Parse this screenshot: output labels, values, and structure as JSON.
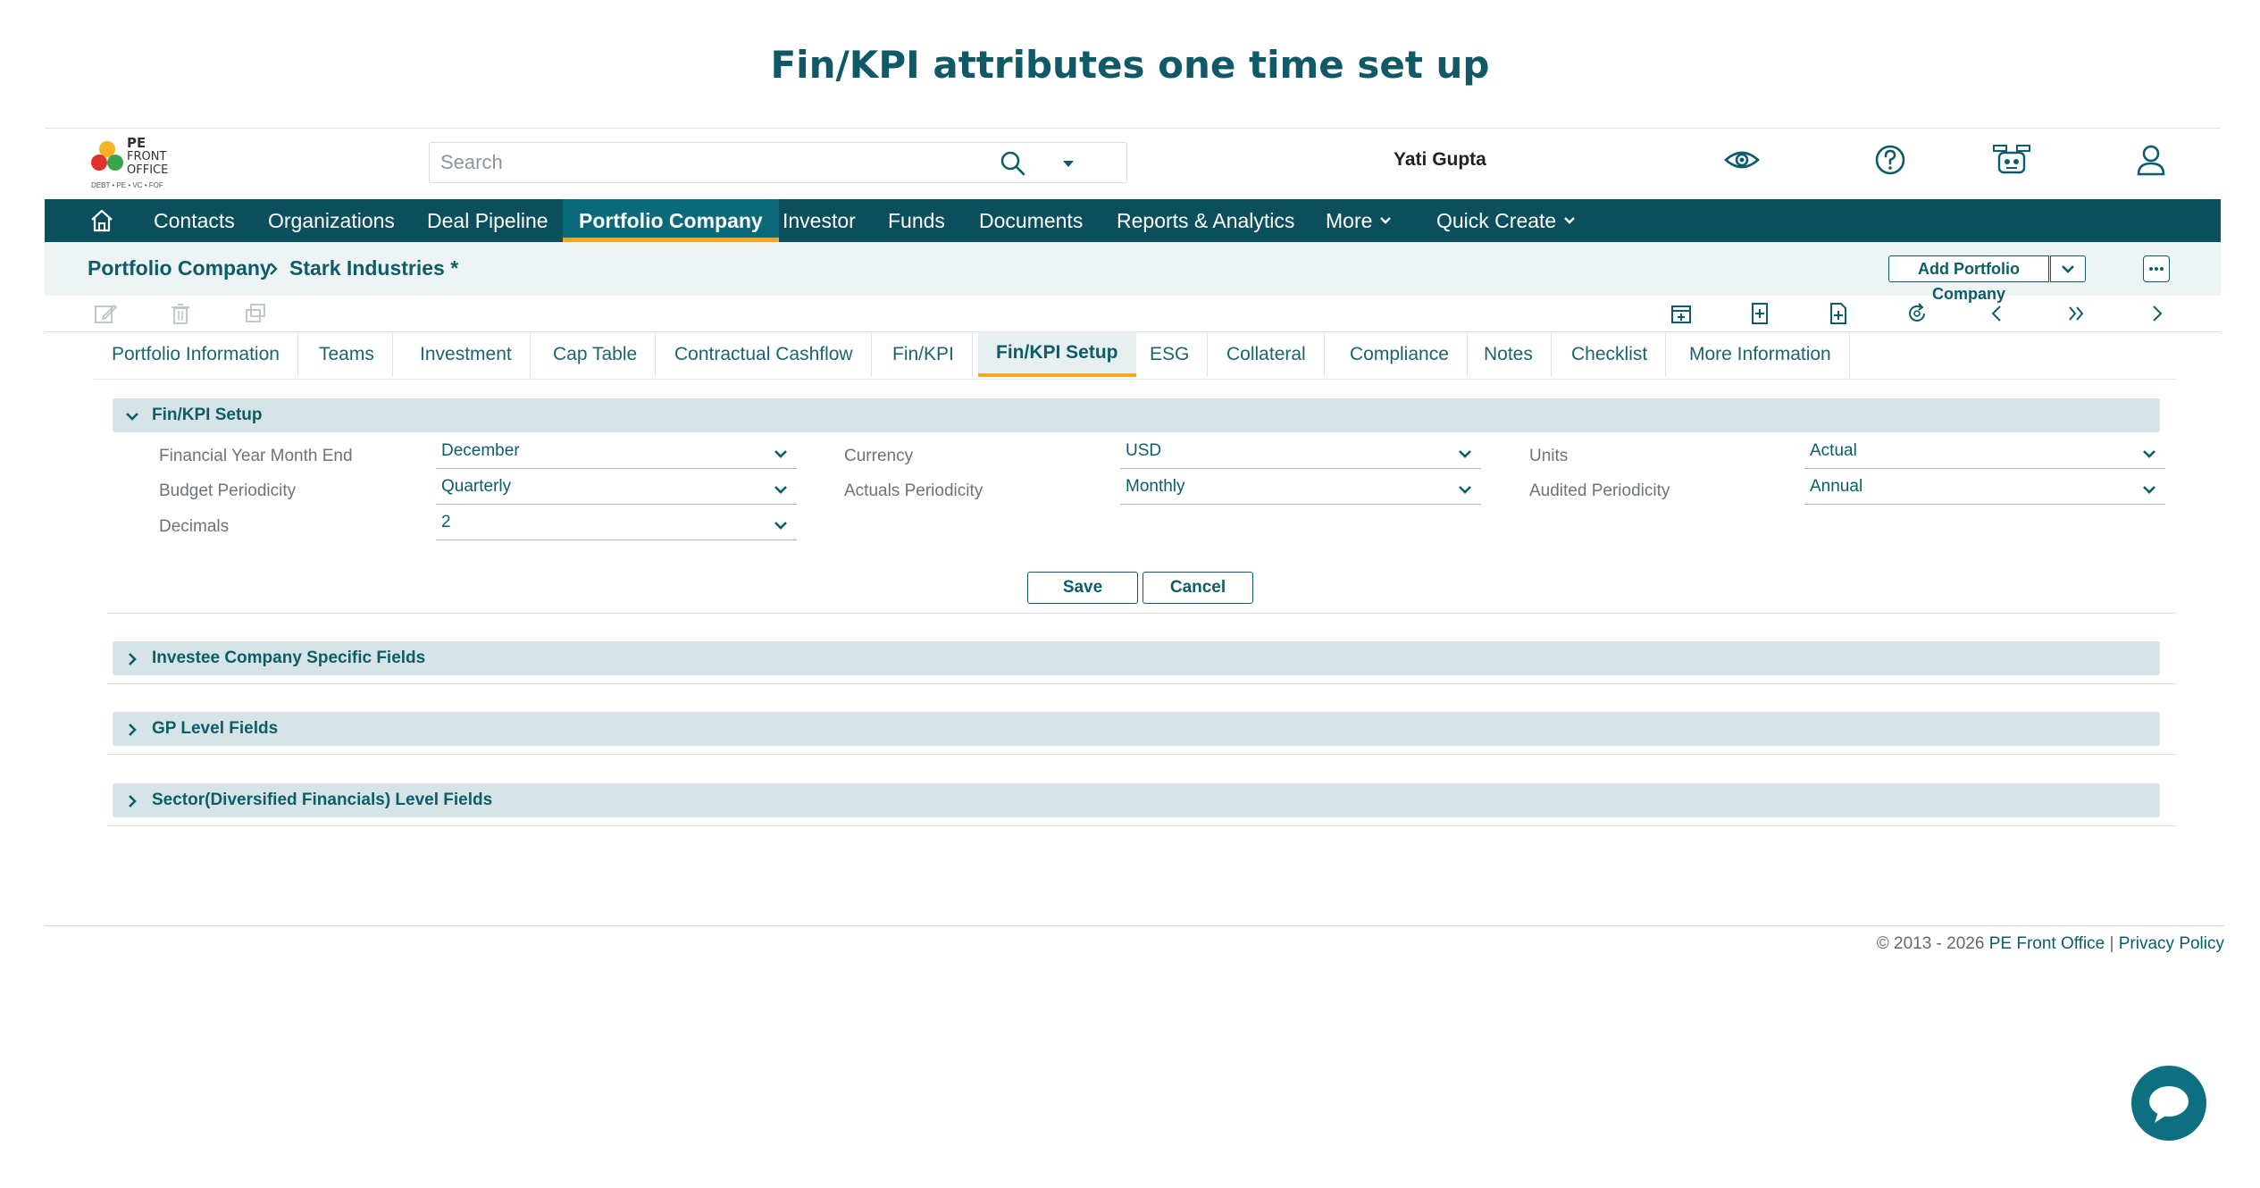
{
  "page_title": "Fin/KPI attributes one time set up",
  "header": {
    "logo_line1": "PE",
    "logo_line2": "FRONT",
    "logo_line3": "OFFICE",
    "logo_tagline": "DEBT • PE • VC • FOF",
    "search_placeholder": "Search",
    "user_name": "Yati Gupta",
    "icons": [
      "eye-icon",
      "help-icon",
      "robot-icon",
      "user-icon"
    ]
  },
  "nav": {
    "items": [
      "Contacts",
      "Organizations",
      "Deal Pipeline",
      "Portfolio Company",
      "Investor",
      "Funds",
      "Documents",
      "Reports & Analytics",
      "More",
      "Quick Create"
    ],
    "active": "Portfolio Company"
  },
  "breadcrumb": {
    "root": "Portfolio Company",
    "current": "Stark Industries *",
    "add_button": "Add Portfolio Company"
  },
  "tabs": [
    "Portfolio Information",
    "Teams",
    "Investment",
    "Cap Table",
    "Contractual Cashflow",
    "Fin/KPI",
    "Fin/KPI Setup",
    "ESG",
    "Collateral",
    "Compliance",
    "Notes",
    "Checklist",
    "More Information"
  ],
  "active_tab": "Fin/KPI Setup",
  "setup": {
    "title": "Fin/KPI Setup",
    "fields": [
      {
        "label": "Financial Year Month End",
        "value": "December"
      },
      {
        "label": "Budget Periodicity",
        "value": "Quarterly"
      },
      {
        "label": "Decimals",
        "value": "2"
      },
      {
        "label": "Currency",
        "value": "USD"
      },
      {
        "label": "Actuals Periodicity",
        "value": "Monthly"
      },
      {
        "label": "Units",
        "value": "Actual"
      },
      {
        "label": "Audited Periodicity",
        "value": "Annual"
      }
    ],
    "save_label": "Save",
    "cancel_label": "Cancel"
  },
  "sections": [
    "Investee Company Specific Fields",
    "GP Level Fields",
    "Sector(Diversified Financials) Level Fields"
  ],
  "footer": {
    "copyright": "© 2013 - 2026",
    "brand_link": "PE Front Office",
    "separator": "|",
    "privacy_link": "Privacy Policy"
  },
  "colors": {
    "nav_bg": "#0c4f5c",
    "accent": "#f5a623",
    "primary_text": "#0c5d69",
    "section_bg": "#d7e4e7"
  }
}
